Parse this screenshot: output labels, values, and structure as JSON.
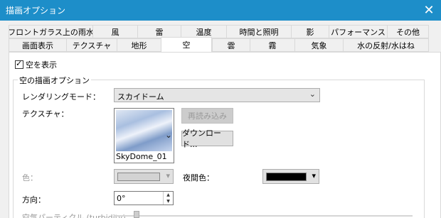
{
  "window": {
    "title": "描画オプション",
    "close_glyph": "✕"
  },
  "tabs_row1": [
    "フロントガラス上の雨水",
    "風",
    "雷",
    "温度",
    "時間と照明",
    "影",
    "パフォーマンス",
    "その他"
  ],
  "tabs_row2": [
    "画面表示",
    "テクスチャ",
    "地形",
    "空",
    "雲",
    "霧",
    "気象",
    "水の反射/水はね"
  ],
  "show_sky": {
    "label": "空を表示",
    "checked": true
  },
  "group_title": "空の描画オプション",
  "rendering_mode": {
    "label": "レンダリングモード：",
    "value": "スカイドーム"
  },
  "texture": {
    "label": "テクスチャ：",
    "name": "SkyDome_01",
    "reload_label": "再読み込み",
    "download_label": "ダウンロード..."
  },
  "color": {
    "label": "色：",
    "swatch": "#d3d3d3"
  },
  "night_color": {
    "label": "夜間色：",
    "swatch": "#000000"
  },
  "direction": {
    "label": "方向：",
    "value": "0°"
  },
  "particle": {
    "label": "空気パーティクル (turbidity)"
  },
  "glyphs": {
    "dropdown_arrow": "⌄",
    "combo_arrow": "▾",
    "spin_up": "▲",
    "spin_down": "▼",
    "chevron": "⌄"
  }
}
